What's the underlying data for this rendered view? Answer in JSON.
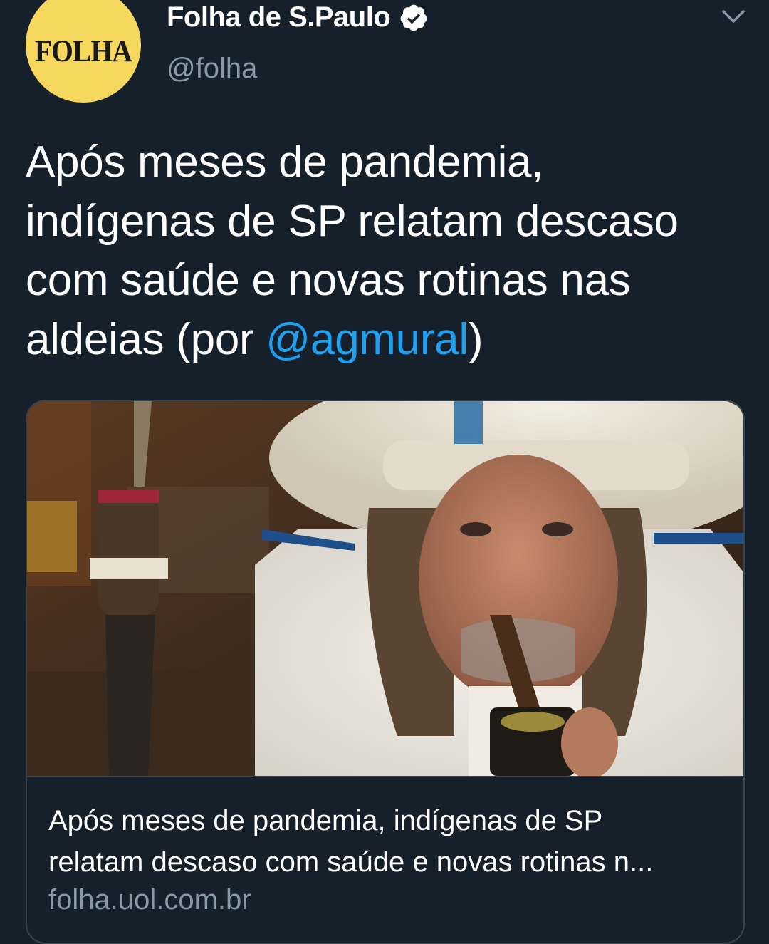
{
  "account": {
    "avatar_text": "FOLHA",
    "display_name": "Folha de S.Paulo",
    "handle": "@folha",
    "verified": true
  },
  "tweet": {
    "lines": [
      "Após meses de pandemia,",
      "indígenas de SP relatam descaso",
      "com saúde e novas rotinas nas"
    ],
    "last_line_prefix": "aldeias (por ",
    "mention": "@agmural",
    "last_line_suffix": ")"
  },
  "card": {
    "title_line1": "Após meses de pandemia, indígenas de SP",
    "title_line2": "relatam descaso com saúde e novas rotinas n...",
    "domain": "folha.uol.com.br"
  },
  "icons": {
    "verified": "verified-badge-icon",
    "menu": "chevron-down-icon"
  },
  "colors": {
    "background": "#15202b",
    "text_primary": "#ffffff",
    "text_secondary": "#8899a6",
    "link": "#1da1f2",
    "border": "#38444d",
    "avatar_bg": "#f5d75e"
  }
}
